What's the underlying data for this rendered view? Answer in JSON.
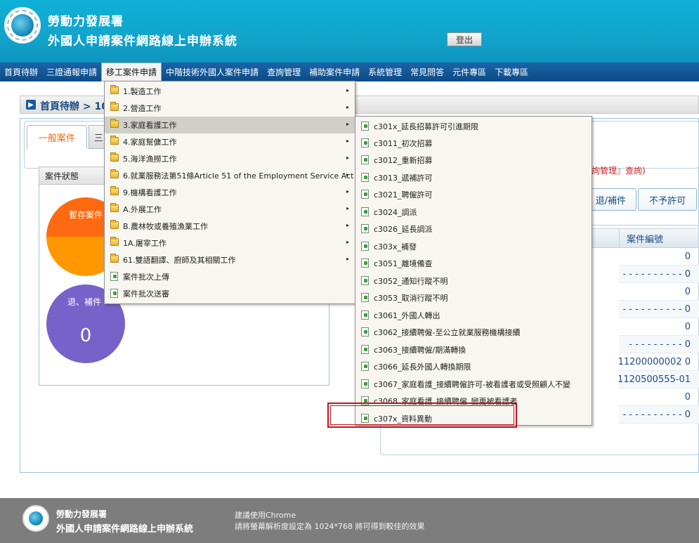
{
  "header": {
    "org_name": "勞動力發展署",
    "system_name": "外國人申請案件網路線上申辦系統",
    "logout_label": "登出"
  },
  "nav": {
    "items": [
      {
        "label": "首頁待辦"
      },
      {
        "label": "三證通報申請"
      },
      {
        "label": "移工案件申請"
      },
      {
        "label": "中階技術外國人案件申請"
      },
      {
        "label": "查詢管理"
      },
      {
        "label": "補助案件申請"
      },
      {
        "label": "系統管理"
      },
      {
        "label": "常見問答"
      },
      {
        "label": "元件專區"
      },
      {
        "label": "下載專區"
      }
    ]
  },
  "breadcrumb": {
    "text": "首頁待辦 > 10"
  },
  "tabs": {
    "general": "一般案件",
    "second": "三"
  },
  "status": {
    "header": "案件狀態",
    "draft_label": "暫存案件",
    "return_label": "退、補件",
    "return_count": "0"
  },
  "notice": {
    "text": "詢管理』查詢)"
  },
  "actions": {
    "return_label": "退/補件",
    "reject_label": "不予許可"
  },
  "table": {
    "case_no_header": "案件編號",
    "rows": [
      "0",
      "- - - - - - - - - - 0",
      "0",
      "- - - - - - - - - - 0",
      "0",
      "- - - - - - - - - 0",
      "11200000002 0",
      "1120500555-01",
      "0",
      "- - - - - - - - - - 0"
    ]
  },
  "menu_level1": {
    "items": [
      {
        "label": "1.製造工作",
        "type": "folder",
        "submenu": true
      },
      {
        "label": "2.營造工作",
        "type": "folder",
        "submenu": true
      },
      {
        "label": "3.家庭看護工作",
        "type": "folder",
        "submenu": true
      },
      {
        "label": "4.家庭幫傭工作",
        "type": "folder",
        "submenu": true
      },
      {
        "label": "5.海洋漁撈工作",
        "type": "folder",
        "submenu": true
      },
      {
        "label": "6.就業服務法第51條Article 51 of the Employment Service Act",
        "type": "folder",
        "submenu": true
      },
      {
        "label": "9.機構看護工作",
        "type": "folder",
        "submenu": true
      },
      {
        "label": "A.外展工作",
        "type": "folder",
        "submenu": true
      },
      {
        "label": "B.農林牧或養殖漁業工作",
        "type": "folder",
        "submenu": true
      },
      {
        "label": "1A.屠宰工作",
        "type": "folder",
        "submenu": true
      },
      {
        "label": "61.雙語翻譯、廚師及其相關工作",
        "type": "folder",
        "submenu": true
      },
      {
        "label": "案件批次上傳",
        "type": "doc",
        "submenu": false
      },
      {
        "label": "案件批次送審",
        "type": "doc",
        "submenu": false
      }
    ],
    "arrow_glyph": "▸"
  },
  "menu_level2": {
    "items": [
      {
        "label": "c301x_延長招募許可引進期限"
      },
      {
        "label": "c3011_初次招募"
      },
      {
        "label": "c3012_重新招募"
      },
      {
        "label": "c3013_遞補許可"
      },
      {
        "label": "c3021_聘僱許可"
      },
      {
        "label": "c3024_調派"
      },
      {
        "label": "c3026_延長調派"
      },
      {
        "label": "c303x_補發"
      },
      {
        "label": "c3051_離境備查"
      },
      {
        "label": "c3052_通知行蹤不明"
      },
      {
        "label": "c3053_取消行蹤不明"
      },
      {
        "label": "c3061_外國人轉出"
      },
      {
        "label": "c3062_接續聘僱-至公立就業服務機構接續"
      },
      {
        "label": "c3063_接續聘僱/期滿轉換"
      },
      {
        "label": "c3066_延長外國人轉換期限"
      },
      {
        "label": "c3067_家庭看護_接續聘僱許可-被看護者或受照顧人不變"
      },
      {
        "label": "c3068_家庭看護_接續聘僱_變更被看護者"
      },
      {
        "label": "c307x_資料異動"
      }
    ]
  },
  "footer": {
    "org_name": "勞動力發展署",
    "system_name": "外國人申請案件網路線上申辦系統",
    "note1": "建議使用Chrome",
    "note2": "請將螢幕解析度設定為 1024*768 將可得到較佳的效果"
  },
  "colors": {
    "header_bg": "#12a4cc",
    "nav_bg": "#0d4b86",
    "highlight": "#c0161c",
    "orange": "#ff6a10",
    "purple": "#7762c9"
  }
}
